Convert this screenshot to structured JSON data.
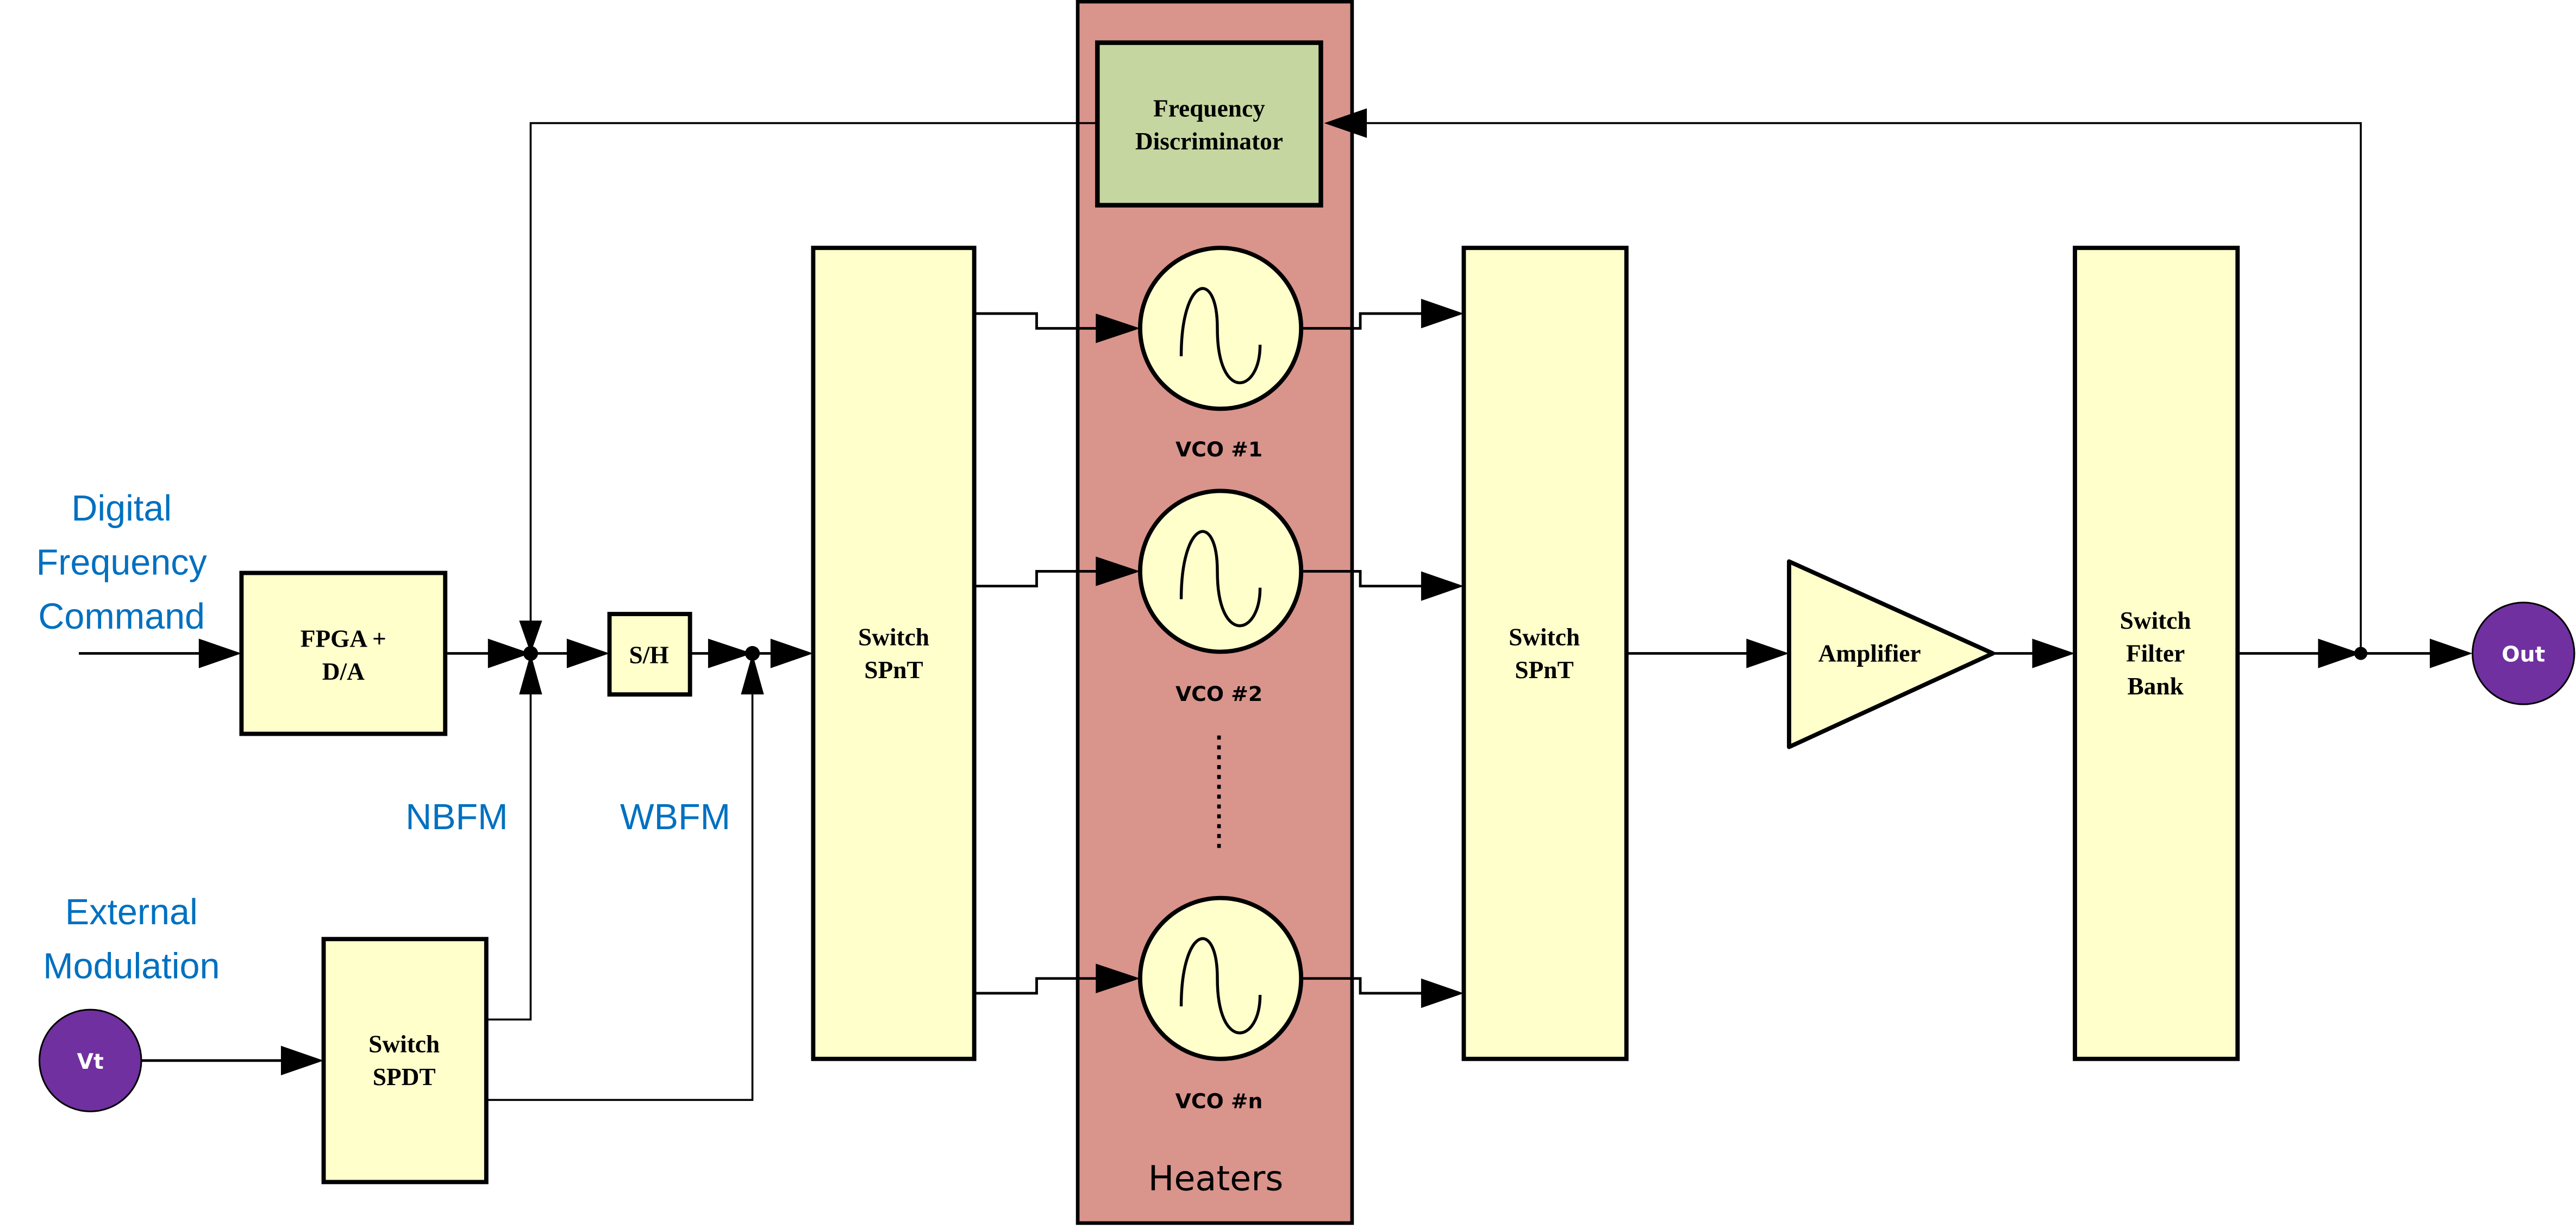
{
  "colors": {
    "block_fill": "#FFFFCC",
    "heater_fill": "#D9948C",
    "discriminator_fill": "#C5D6A0",
    "port_fill": "#7030A0",
    "annotation_text": "#0070C0",
    "line": "#000000"
  },
  "annotations": {
    "digital_command": [
      "Digital",
      "Frequency",
      "Command"
    ],
    "external_modulation": [
      "External",
      "Modulation"
    ],
    "nbfm": "NBFM",
    "wbfm": "WBFM"
  },
  "ports": {
    "vt": "Vt",
    "out": "Out"
  },
  "blocks": {
    "fpga": [
      "FPGA +",
      "D/A"
    ],
    "sample_hold": "S/H",
    "switch_spdt": [
      "Switch",
      "SPDT"
    ],
    "switch_spnt_in": [
      "Switch",
      "SPnT"
    ],
    "switch_spnt_out": [
      "Switch",
      "SPnT"
    ],
    "frequency_discriminator": [
      "Frequency",
      "Discriminator"
    ],
    "amplifier": "Amplifier",
    "switch_filter_bank": [
      "Switch",
      "Filter",
      "Bank"
    ]
  },
  "heaters": {
    "label": "Heaters",
    "vcos": [
      {
        "label": "VCO #1",
        "icon": "sine-wave-icon"
      },
      {
        "label": "VCO #2",
        "icon": "sine-wave-icon"
      },
      {
        "label": "VCO #n",
        "icon": "sine-wave-icon"
      }
    ],
    "ellipsis": "vertical-dotted-ellipsis"
  }
}
